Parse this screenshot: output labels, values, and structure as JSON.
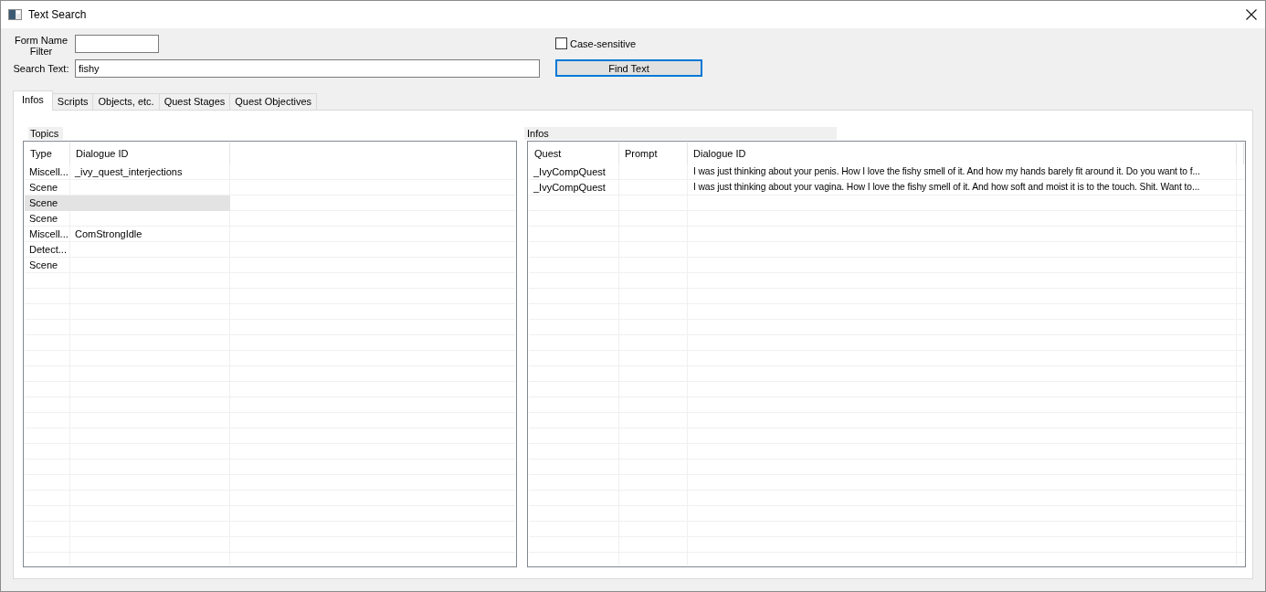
{
  "window": {
    "title": "Text Search"
  },
  "filters": {
    "form_name_filter": {
      "label": "Form Name Filter"
    },
    "search_text": {
      "label": "Search Text:",
      "value": "fishy"
    },
    "case_sensitive": {
      "label": "Case-sensitive",
      "checked": false
    },
    "find_button": {
      "label": "Find Text",
      "focused": true
    }
  },
  "tabs": [
    {
      "label": "Infos",
      "selected": true
    },
    {
      "label": "Scripts",
      "selected": false
    },
    {
      "label": "Objects, etc.",
      "selected": false
    },
    {
      "label": "Quest Stages",
      "selected": false
    },
    {
      "label": "Quest Objectives",
      "selected": false
    }
  ],
  "topics": {
    "title": "Topics",
    "columns": [
      "Type",
      "Dialogue ID"
    ],
    "rows": [
      {
        "type": "Miscell...",
        "dialogue_id": "_ivy_quest_interjections",
        "selected": false
      },
      {
        "type": "Scene",
        "selected": false
      },
      {
        "type": "Scene",
        "selected": true
      },
      {
        "type": "Scene",
        "selected": false
      },
      {
        "type": "Miscell...",
        "dialogue_id": "ComStrongIdle",
        "selected": false
      },
      {
        "type": "Detect...",
        "selected": false
      },
      {
        "type": "Scene",
        "selected": false
      }
    ]
  },
  "infos": {
    "title": "Infos",
    "columns": [
      "Quest",
      "Prompt",
      "Dialogue ID"
    ],
    "rows": [
      {
        "quest": "_IvyCompQuest",
        "dialogue_id": "I was just thinking about your penis. How I love the fishy smell of it. And how my hands barely fit around it. Do you want to f...",
        "selected": false
      },
      {
        "quest": "_IvyCompQuest",
        "dialogue_id": "I was just thinking about your vagina. How I love the fishy smell of it. And how soft and moist it is to the touch. Shit. Want to...",
        "selected": false
      }
    ]
  }
}
